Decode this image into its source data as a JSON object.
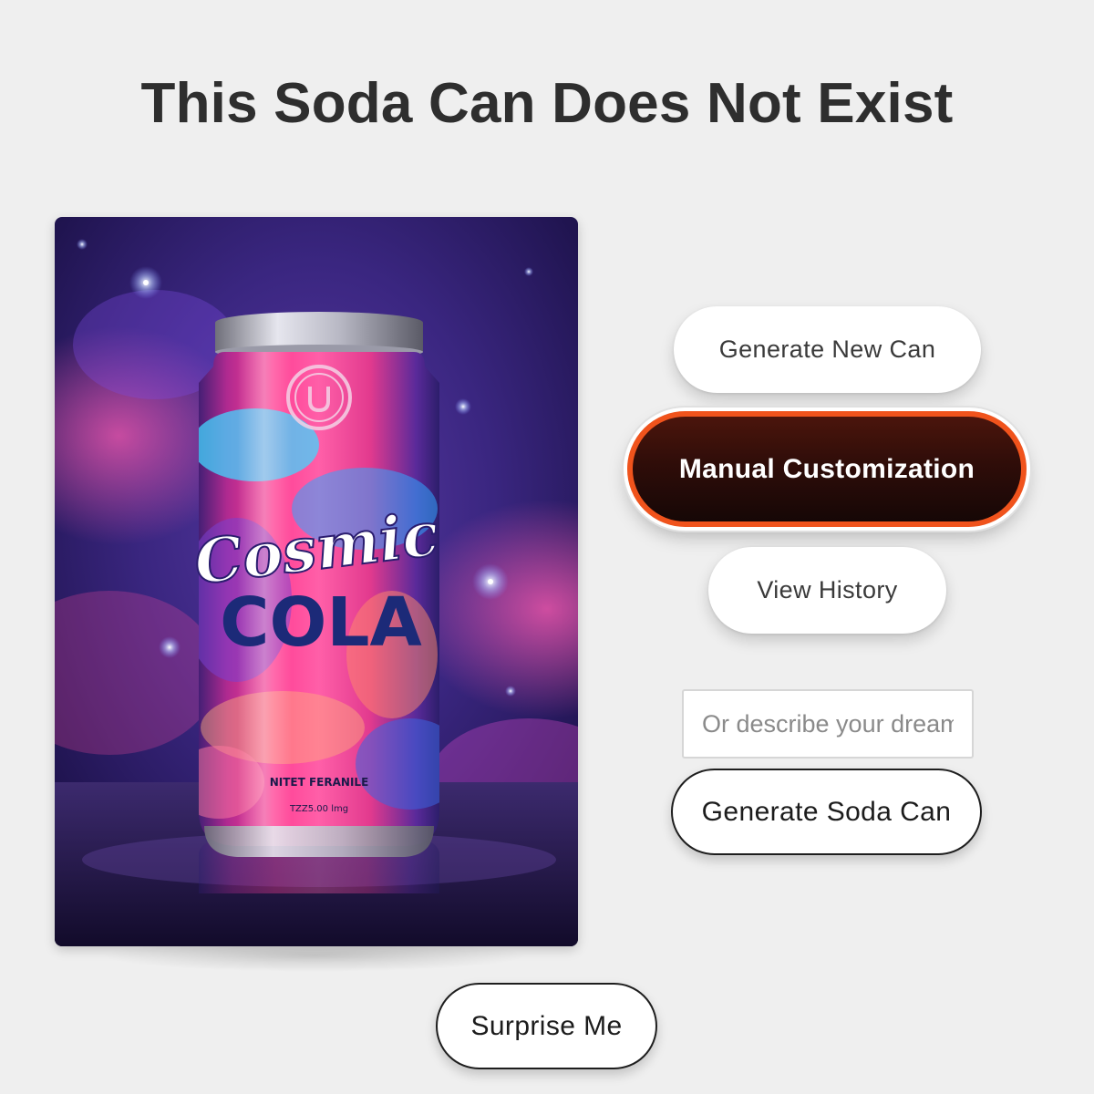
{
  "page": {
    "title": "This Soda Can Does Not Exist"
  },
  "can_image": {
    "brand_line1": "Cosmic",
    "brand_line2": "COLA",
    "small_text": "NITET FERANILE",
    "volume_text": "TZZ5.00 lmg",
    "accent_colors": {
      "pink": "#ff2f8e",
      "cyan": "#2fd0ff",
      "navy": "#1a2470",
      "purple": "#4a2a8a"
    }
  },
  "actions": {
    "generate_new": "Generate New Can",
    "manual_customization": "Manual Customization",
    "view_history": "View History",
    "generate_soda": "Generate Soda Can",
    "surprise": "Surprise Me"
  },
  "prompt": {
    "placeholder": "Or describe your dream soda can...",
    "value": ""
  },
  "colors": {
    "background": "#efefef",
    "accent_border": "#f0531c",
    "manual_fill": "#2f0d09"
  }
}
